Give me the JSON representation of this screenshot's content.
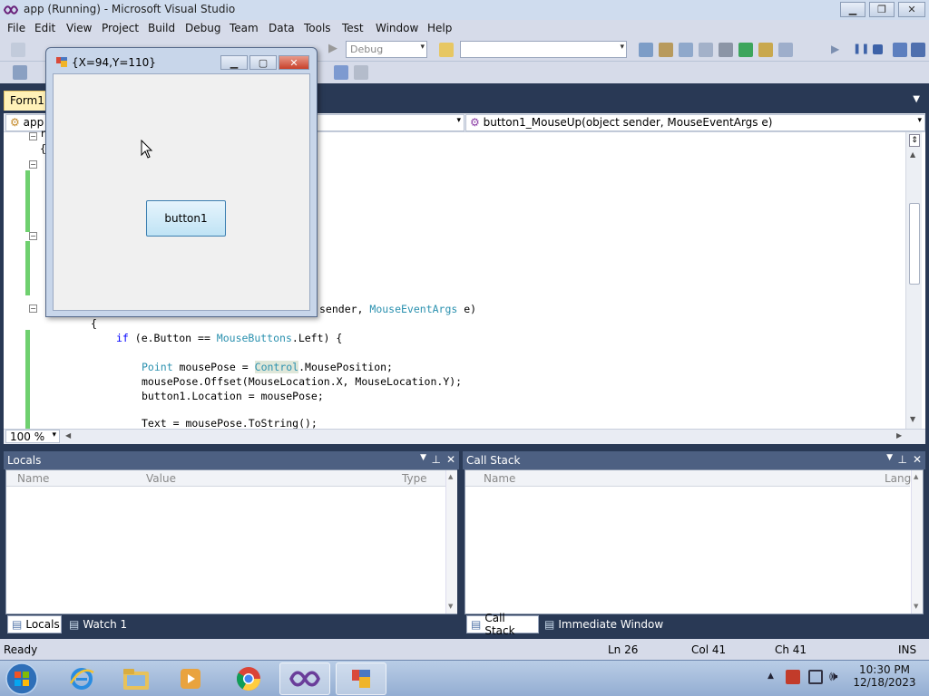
{
  "window": {
    "title": "app (Running) - Microsoft Visual Studio",
    "minimize": "▁",
    "restore": "❐",
    "close": "✕"
  },
  "menu": [
    "File",
    "Edit",
    "View",
    "Project",
    "Build",
    "Debug",
    "Team",
    "Data",
    "Tools",
    "Test",
    "Window",
    "Help"
  ],
  "toolbar": {
    "config_combo": "Debug",
    "find_combo": ""
  },
  "document": {
    "tab_label": "Form1.c",
    "nav_left": "app",
    "nav_right": "button1_MouseUp(object sender, MouseEventArgs e)"
  },
  "code": {
    "line_r": "r",
    "line_brace_open": "{",
    "line_sig_a": "sender, ",
    "line_sig_type": "MouseEventArgs",
    "line_sig_b": " e)",
    "line_brace2": "{",
    "line_if_kw": "if",
    "line_if_a": " (e.Button == ",
    "line_if_type": "MouseButtons",
    "line_if_b": ".Left) {",
    "line_point_type": "Point",
    "line_point_a": " mousePose = ",
    "line_point_hl": "Control",
    "line_point_b": ".MousePosition;",
    "line_offset": "mousePose.Offset(MouseLocation.X, MouseLocation.Y);",
    "line_location": "button1.Location = mousePose;",
    "line_text": "Text = mousePose.ToString();"
  },
  "zoom": "100 %",
  "form": {
    "title": "{X=94,Y=110}",
    "button_label": "button1"
  },
  "locals": {
    "title": "Locals",
    "columns": [
      "Name",
      "Value",
      "Type"
    ],
    "tabs": [
      "Locals",
      "Watch 1"
    ]
  },
  "callstack": {
    "title": "Call Stack",
    "columns": [
      "Name",
      "Lang"
    ],
    "tabs": [
      "Call Stack",
      "Immediate Window"
    ]
  },
  "status": {
    "ready": "Ready",
    "ln": "Ln 26",
    "col": "Col 41",
    "ch": "Ch 41",
    "ins": "INS"
  },
  "clock": {
    "time": "10:30 PM",
    "date": "12/18/2023"
  },
  "colors": {
    "chrome": "#293955",
    "panel_header": "#4d6082",
    "keyword": "#0000ff",
    "type": "#2b91af"
  }
}
